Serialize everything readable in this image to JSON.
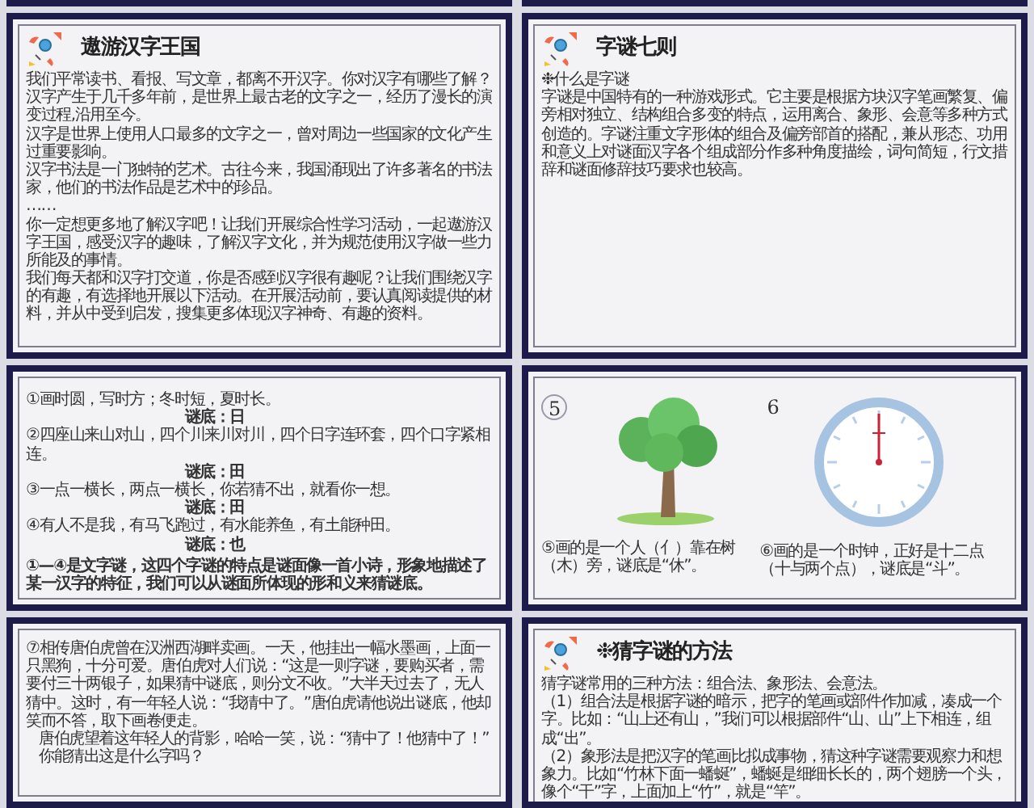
{
  "slides": [
    {
      "kind": "titled",
      "title": "遨游汉字王国",
      "paragraphs": [
        "我们平常读书、看报、写文章，都离不开汉字。你对汉字有哪些了解？",
        "汉字产生于几千多年前，是世界上最古老的文字之一，经历了漫长的演变过程,沿用至今。",
        "汉字是世界上使用人口最多的文字之一，曾对周边一些国家的文化产生过重要影响。",
        "汉字书法是一门独特的艺术。古往今来，我国涌现出了许多著名的书法家，他们的书法作品是艺术中的珍品。",
        "……",
        "你一定想更多地了解汉字吧！让我们开展综合性学习活动，一起遨游汉字王国，感受汉字的趣味，了解汉字文化，并为规范使用汉字做一些力所能及的事情。",
        "我们每天都和汉字打交道，你是否感到汉字很有趣呢？让我们围绕汉字的有趣，有选择地开展以下活动。在开展活动前，要认真阅读提供的材料，并从中受到启发，搜集更多体现汉字神奇、有趣的资料。"
      ]
    },
    {
      "kind": "titled",
      "title": "字谜七则",
      "paragraphs": [
        "❉什么是字谜",
        "字谜是中国特有的一种游戏形式。它主要是根据方块汉字笔画繁复、偏旁相对独立、结构组合多变的特点，运用离合、象形、会意等多种方式创造的。字谜注重文字形体的组合及偏旁部首的搭配，兼从形态、功用和意义上对谜面汉字各个组成部分作多种角度描绘，词句简短，行文措辞和谜面修辞技巧要求也较高。"
      ]
    },
    {
      "kind": "riddles",
      "items": [
        {
          "text": "①画时圆，写时方；冬时短，夏时长。",
          "answer": "谜底：日"
        },
        {
          "text": "②四座山来山对山，四个川来川对川，四个日字连环套，四个口字紧相连。",
          "answer": "谜底：田"
        },
        {
          "text": "③一点一横长，两点一横长，你若猜不出，就看你一想。",
          "answer": "谜底：田"
        },
        {
          "text": "④有人不是我，有马飞跑过，有水能养鱼，有土能种田。",
          "answer": "谜底：也"
        }
      ],
      "note": "①—④是文字谜，这四个字谜的特点是谜面像一首小诗，形象地描述了某一汉字的特征，我们可以从谜面所体现的形和义来猜谜底。"
    },
    {
      "kind": "pictures",
      "panels": [
        {
          "number": "5",
          "circled": true,
          "kind": "tree",
          "caption": "⑤画的是一个人（亻）靠在树（木）旁，谜底是“休”。"
        },
        {
          "number": "6",
          "circled": false,
          "kind": "clock",
          "caption": "⑥画的是一个时钟，正好是十二点（十与两个点），谜底是“斗”。"
        }
      ]
    },
    {
      "kind": "story",
      "paragraphs": [
        "⑦相传唐伯虎曾在汉洲西湖畔卖画。一天，他挂出一幅水墨画，上面一只黑狗，十分可爱。唐伯虎对人们说：“这是一则字谜，要购买者，需要付三十两银子，如果猜中谜底，则分文不收。”大半天过去了，无人猜中。这时，有一年轻人说：“我猜中了。”唐伯虎请他说出谜底，他却笑而不答，取下画卷便走。",
        "唐伯虎望着这年轻人的背影，哈哈一笑，说：“猜中了！他猜中了！”",
        "你能猜出这是什么字吗？"
      ]
    },
    {
      "kind": "titled",
      "title": "❉猜字谜的方法",
      "paragraphs": [
        "猜字谜常用的三种方法：组合法、象形法、会意法。",
        "（1）组合法是根据字谜的暗示，把字的笔画或部件作加减，凑成一个字。比如：“山上还有山，”我们可以根据部件“山、山”上下相连，组成“出”。",
        "（2）象形法是把汉字的笔画比拟成事物，猜这种字谜需要观察力和想象力。比如“竹林下面一蟠蜒”，蟠蜒是细细长长的，两个翅膀一个头，像个“干”字，上面加上“竹”，就是“竿”。"
      ]
    }
  ]
}
